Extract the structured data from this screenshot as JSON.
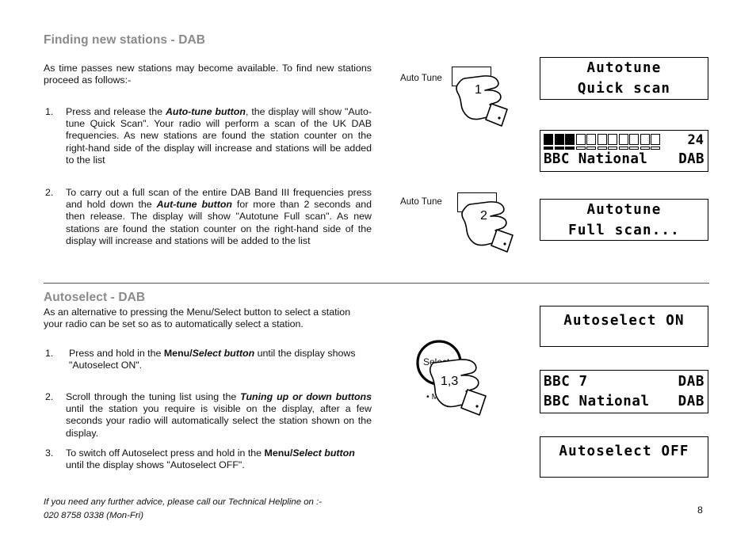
{
  "document": {
    "page_number": "8",
    "footer_line1": "If you need any further advice, please call our Technical Helpline on :-",
    "footer_line2": "020 8758 0338 (Mon-Fri)"
  },
  "colors": {
    "heading": "#8a8a8a",
    "text": "#111111",
    "rule": "#555555",
    "lcd_border": "#000000",
    "lcd_background": "#ffffff"
  },
  "section1": {
    "heading": "Finding new stations - DAB",
    "intro": "As time passes new stations may become available. To find new stations proceed as follows:-",
    "items": [
      {
        "number": "1.",
        "text_parts": [
          {
            "text": "Press and release the ",
            "style": "normal"
          },
          {
            "text": "Auto-tune button",
            "style": "bold-italic"
          },
          {
            "text": ", the display will show \"Auto-tune Quick Scan\". Your radio will perform a scan of the UK DAB frequencies. As new stations are found the station counter on the right-hand side of the display will increase and stations will be added to the list",
            "style": "normal"
          }
        ]
      },
      {
        "number": "2.",
        "text_parts": [
          {
            "text": "To carry out a full scan of the entire DAB Band III frequencies press and hold down the ",
            "style": "normal"
          },
          {
            "text": "Aut-tune button",
            "style": "bold-italic"
          },
          {
            "text": " for more than 2 seconds and then release. The display will show \"Autotune Full scan\". As new stations are found the station counter on the right-hand side of the display will increase and stations will be added to the list",
            "style": "normal"
          }
        ]
      }
    ]
  },
  "section2": {
    "heading": "Autoselect - DAB",
    "intro": "As an alternative to pressing the Menu/Select button to select a station your radio can be set so as to automatically select a station.",
    "items": [
      {
        "number": "1.",
        "text_parts": [
          {
            "text": "Press and hold in the ",
            "style": "normal"
          },
          {
            "text": "Menu/",
            "style": "bold"
          },
          {
            "text": "Select button",
            "style": "bold-italic"
          },
          {
            "text": " until the display shows \"Autoselect ON\".",
            "style": "normal"
          }
        ]
      },
      {
        "number": "2.",
        "text_parts": [
          {
            "text": "Scroll through the tuning list using the ",
            "style": "normal"
          },
          {
            "text": "Tuning up or down buttons",
            "style": "bold-italic"
          },
          {
            "text": " until the station you require is visible on the display, after a few seconds your radio will automatically select the station shown on the display.",
            "style": "normal"
          }
        ]
      },
      {
        "number": "3.",
        "text_parts": [
          {
            "text": "To switch off Autoselect press and hold in the ",
            "style": "normal"
          },
          {
            "text": "Menu/",
            "style": "bold"
          },
          {
            "text": "Select button",
            "style": "bold-italic"
          },
          {
            "text": " until the display shows \"Autoselect OFF\".",
            "style": "normal"
          }
        ]
      }
    ]
  },
  "illustrations": [
    {
      "id": "auto-tune-press-1",
      "button_label": "Auto Tune",
      "step_number": "1",
      "control_type": "rectangular-button"
    },
    {
      "id": "auto-tune-press-2",
      "button_label": "Auto Tune",
      "step_number": "2",
      "control_type": "rectangular-button"
    },
    {
      "id": "menu-select-knob",
      "knob_label": "Select",
      "secondary_label": "Menu",
      "step_number": "1,3",
      "control_type": "rotary-knob"
    }
  ],
  "displays": [
    {
      "id": "display-autotune-quick-scan",
      "type": "text",
      "line1": "Autotune",
      "line2": "Quick scan"
    },
    {
      "id": "display-scan-progress",
      "type": "progress",
      "blocks_total": 11,
      "blocks_filled": 3,
      "counter": "24",
      "station_name": "BBC National",
      "band": "DAB"
    },
    {
      "id": "display-autotune-full-scan",
      "type": "text",
      "line1": "Autotune",
      "line2": "Full scan..."
    },
    {
      "id": "display-autoselect-on",
      "type": "text",
      "line1": "Autoselect ON",
      "line2": ""
    },
    {
      "id": "display-station-list",
      "type": "list",
      "row1_left": "BBC 7",
      "row1_right": "DAB",
      "row2_left": "BBC National",
      "row2_right": "DAB"
    },
    {
      "id": "display-autoselect-off",
      "type": "text",
      "line1": "Autoselect OFF",
      "line2": ""
    }
  ]
}
